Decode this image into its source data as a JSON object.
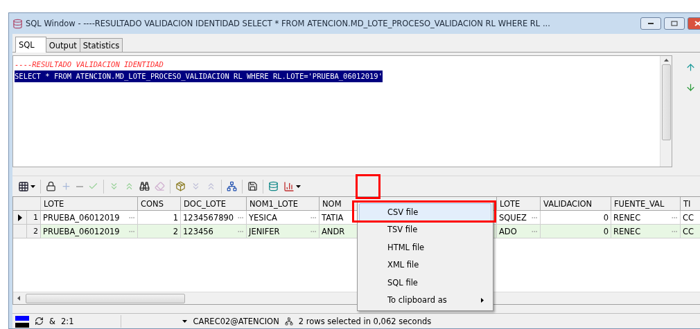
{
  "window": {
    "title": "SQL Window - ----RESULTADO VALIDACION IDENTIDAD SELECT * FROM ATENCION.MD_LOTE_PROCESO_VALIDACION RL WHERE RL ..."
  },
  "tabs": [
    {
      "label": "SQL",
      "selected": true
    },
    {
      "label": "Output",
      "selected": false
    },
    {
      "label": "Statistics",
      "selected": false
    }
  ],
  "editor": {
    "lines": [
      {
        "kind": "comment",
        "text": "----RESULTADO VALIDACION IDENTIDAD",
        "selected": false
      },
      {
        "kind": "statement",
        "text": "SELECT * FROM ATENCION.MD_LOTE_PROCESO_VALIDACION RL WHERE RL.LOTE='PRUEBA_06012019'",
        "selected": true
      }
    ]
  },
  "grid": {
    "columns": [
      {
        "label": "LOTE",
        "kind": "text"
      },
      {
        "label": "CONS",
        "kind": "number"
      },
      {
        "label": "DOC_LOTE",
        "kind": "text"
      },
      {
        "label": "NOM1_LOTE",
        "kind": "text"
      },
      {
        "label": "NOM",
        "kind": "plain"
      },
      {
        "label": "LOTE",
        "kind": "text"
      },
      {
        "label": "VALIDACION",
        "kind": "number"
      },
      {
        "label": "FUENTE_VAL",
        "kind": "text"
      },
      {
        "label": "TI",
        "kind": "plain"
      }
    ],
    "rows": [
      {
        "number": "1",
        "current": true,
        "cells": [
          "PRUEBA_06012019",
          "1",
          "1234567890",
          "YESICA",
          "TATIA",
          "SQUEZ",
          "0",
          "RENEC",
          "CC"
        ]
      },
      {
        "number": "2",
        "current": false,
        "cells": [
          "PRUEBA_06012019",
          "2",
          "123456",
          "JENIFER",
          "ANDR",
          "ADO",
          "0",
          "RENEC",
          "CC"
        ]
      }
    ]
  },
  "export_menu": {
    "items": [
      {
        "label": "CSV file",
        "selected": true,
        "submenu": false
      },
      {
        "label": "TSV file",
        "selected": false,
        "submenu": false
      },
      {
        "label": "HTML file",
        "selected": false,
        "submenu": false
      },
      {
        "label": "XML file",
        "selected": false,
        "submenu": false
      },
      {
        "label": "SQL file",
        "selected": false,
        "submenu": false
      },
      {
        "label": "To clipboard as",
        "selected": false,
        "submenu": true
      }
    ]
  },
  "status_bar": {
    "shortcut": "&",
    "position": "2:1",
    "connection": "CAREC02@ATENCION",
    "message": "2 rows selected in 0,062 seconds"
  }
}
